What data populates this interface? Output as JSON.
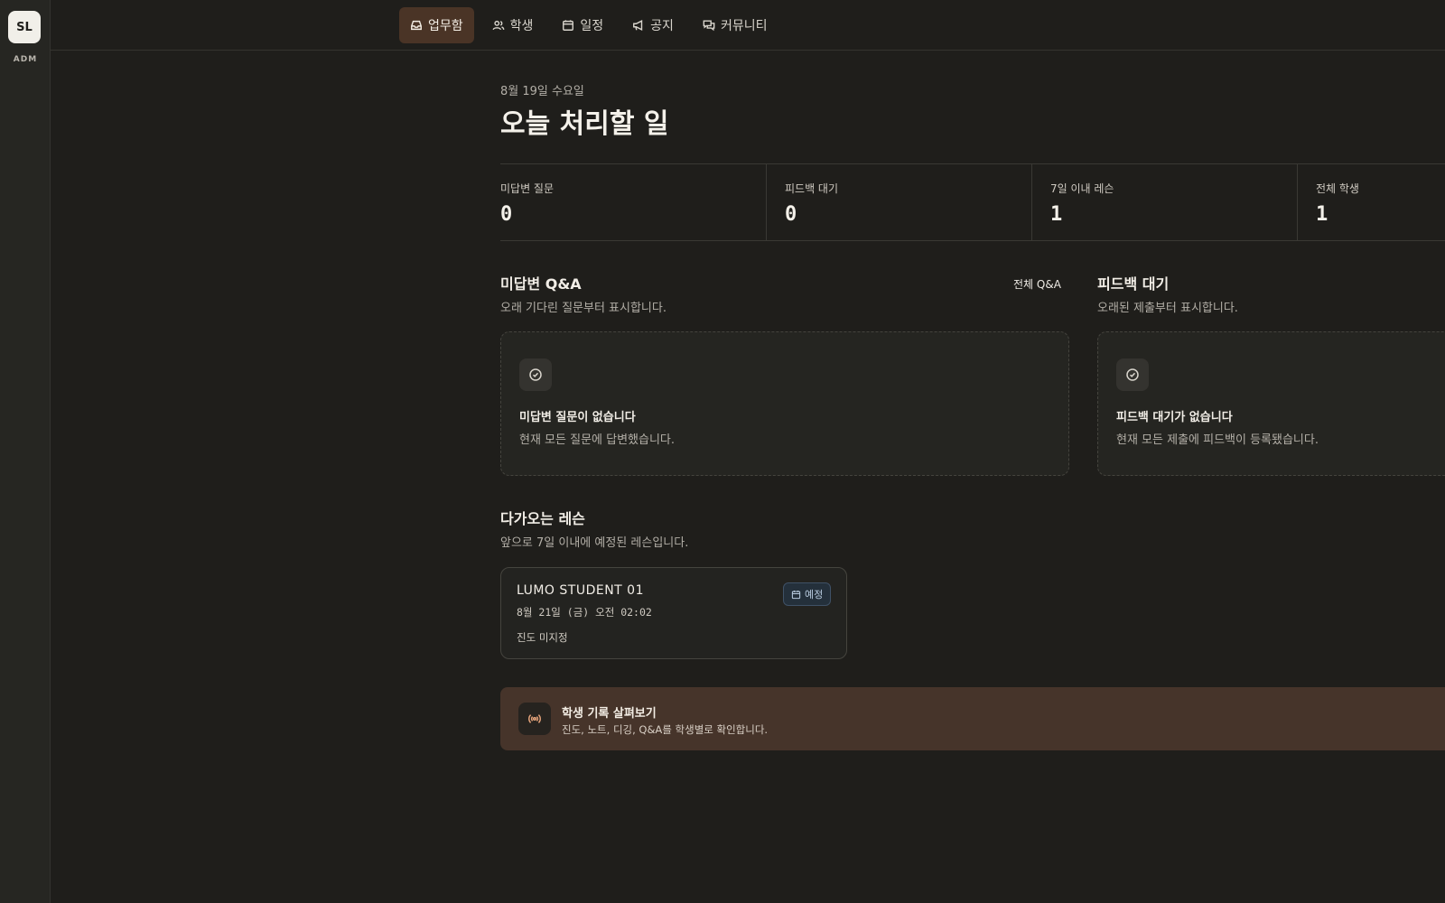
{
  "sidebar": {
    "avatar_initials": "SL",
    "role": "ADM"
  },
  "nav": {
    "items": [
      {
        "label": "업무함",
        "icon": "inbox-icon",
        "active": true
      },
      {
        "label": "학생",
        "icon": "users-icon",
        "active": false
      },
      {
        "label": "일정",
        "icon": "calendar-icon",
        "active": false
      },
      {
        "label": "공지",
        "icon": "megaphone-icon",
        "active": false
      },
      {
        "label": "커뮤니티",
        "icon": "chat-icon",
        "active": false
      }
    ]
  },
  "header": {
    "date": "8월 19일 수요일",
    "title": "오늘 처리할 일"
  },
  "stats": [
    {
      "label": "미답변 질문",
      "value": "0"
    },
    {
      "label": "피드백 대기",
      "value": "0"
    },
    {
      "label": "7일 이내 레슨",
      "value": "1"
    },
    {
      "label": "전체 학생",
      "value": "1"
    }
  ],
  "qa": {
    "title": "미답변 Q&A",
    "subtitle": "오래 기다린 질문부터 표시합니다.",
    "link": "전체 Q&A",
    "empty_title": "미답변 질문이 없습니다",
    "empty_desc": "현재 모든 질문에 답변했습니다."
  },
  "feedback": {
    "title": "피드백 대기",
    "subtitle": "오래된 제출부터 표시합니다.",
    "empty_title": "피드백 대기가 없습니다",
    "empty_desc": "현재 모든 제출에 피드백이 등록됐습니다."
  },
  "lessons": {
    "title": "다가오는 레슨",
    "subtitle": "앞으로 7일 이내에 예정된 레슨입니다.",
    "items": [
      {
        "student": "LUMO STUDENT 01",
        "time": "8월 21일 (금) 오전 02:02",
        "progress": "진도 미지정",
        "badge": "예정"
      }
    ]
  },
  "banner": {
    "title": "학생 기록 살펴보기",
    "subtitle": "진도, 노트, 디깅, Q&A를 학생별로 확인합니다.",
    "icon": "broadcast-icon"
  },
  "colors": {
    "background": "#1f1e1b",
    "active_nav": "#4a3426",
    "banner": "#46342a",
    "badge": "#24303b",
    "accent": "#e4a27a"
  }
}
